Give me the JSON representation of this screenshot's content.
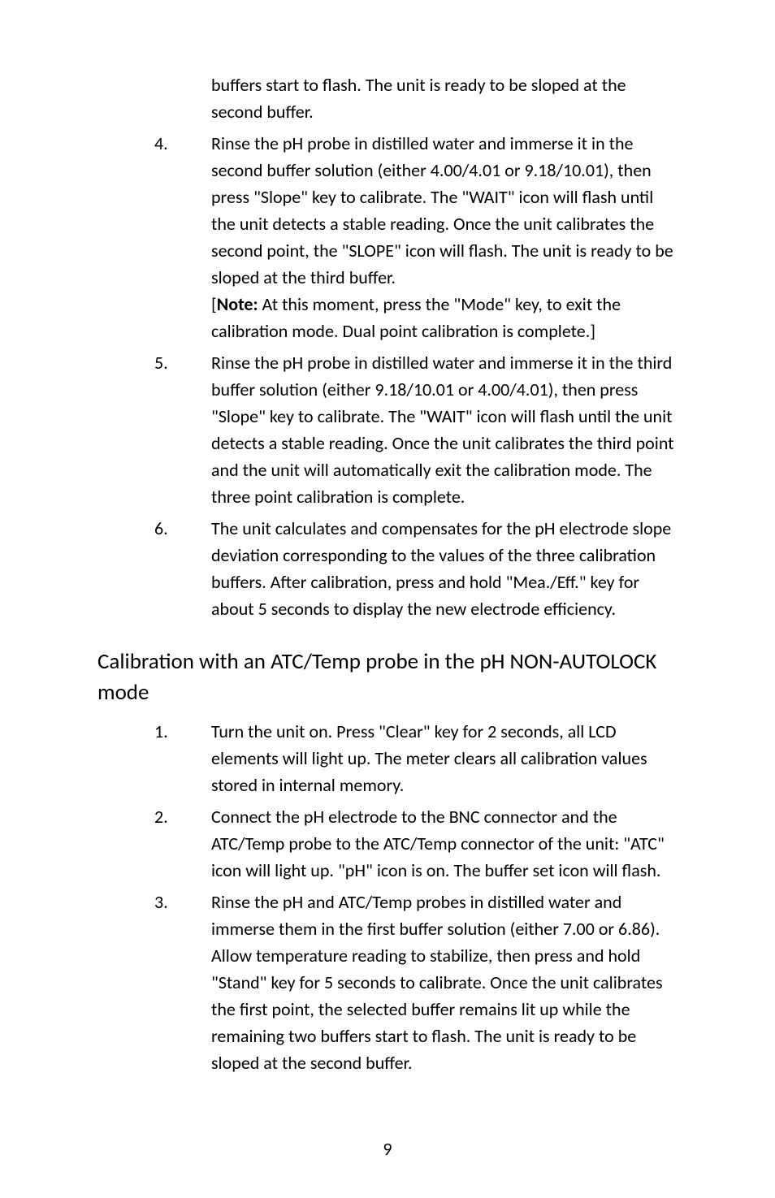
{
  "top_continuation": "buffers start to flash. The unit is ready to be sloped at the second buffer.",
  "first_list": [
    {
      "n": "4.",
      "t": "Rinse the pH probe in distilled water and immerse it in the second buffer solution (either 4.00/4.01 or 9.18/10.01), then press \"Slope\" key to calibrate. The \"WAIT\" icon will flash until the unit detects a stable reading. Once the unit calibrates the second point, the \"SLOPE\" icon will flash. The unit is ready to be sloped at the third buffer."
    },
    {
      "n": "5.",
      "t": "Rinse the pH probe in distilled water and immerse it in the third buffer solution (either 9.18/10.01 or 4.00/4.01), then press \"Slope\" key to calibrate. The \"WAIT\" icon will flash until the unit detects a stable reading. Once the unit calibrates the third point and the unit will automatically exit the calibration mode. The three point calibration is complete."
    },
    {
      "n": "6.",
      "t": "The unit calculates and compensates for the pH electrode slope deviation corresponding to the values of the three calibration buffers. After calibration, press and hold \"Mea./Eff.\" key for about 5 seconds to display the new electrode efficiency."
    }
  ],
  "note_prefix": "[",
  "note_label": "Note:",
  "note_body": " At this moment, press the \"Mode\" key, to exit the calibration mode. Dual point calibration is complete.]",
  "heading": "Calibration with an ATC/Temp probe in the pH NON-AUTOLOCK mode",
  "second_list": [
    {
      "n": "1.",
      "t": "Turn the unit on. Press \"Clear\" key for 2 seconds, all LCD elements will light up. The meter clears all calibration values stored in internal memory."
    },
    {
      "n": "2.",
      "t": "Connect the pH electrode to the BNC connector and the ATC/Temp probe to the ATC/Temp connector of the unit: \"ATC\" icon will light up. \"pH\" icon is on. The buffer set icon will flash."
    },
    {
      "n": "3.",
      "t": "Rinse the pH and ATC/Temp probes in distilled water and immerse them in the first buffer solution (either 7.00 or 6.86). Allow temperature reading to stabilize, then press and hold \"Stand\" key for 5 seconds to calibrate. Once the unit calibrates the first point, the selected buffer remains lit up while the remaining two buffers start to flash. The unit is ready to be sloped at the second buffer."
    }
  ],
  "page_number": "9"
}
